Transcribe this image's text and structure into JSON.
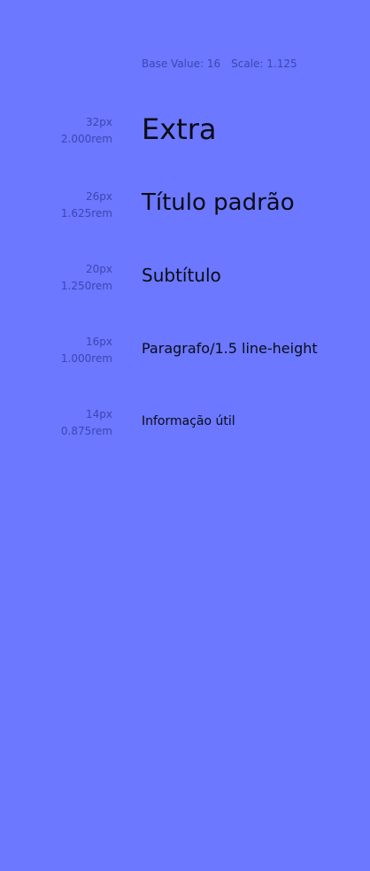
{
  "meta": {
    "base": "Base Value: 16",
    "scale": "Scale: 1.125"
  },
  "rows": [
    {
      "px": "32px",
      "rem": "2.000rem",
      "sample": "Extra"
    },
    {
      "px": "26px",
      "rem": "1.625rem",
      "sample": "Título padrão"
    },
    {
      "px": "20px",
      "rem": "1.250rem",
      "sample": "Subtítulo"
    },
    {
      "px": "16px",
      "rem": "1.000rem",
      "sample": "Paragrafo/1.5 line-height"
    },
    {
      "px": "14px",
      "rem": "0.875rem",
      "sample": "Informação útil"
    }
  ],
  "colors": {
    "background": "#6b78ff",
    "sample_text": "#0b0b14",
    "meta_text": "#2d3696"
  }
}
